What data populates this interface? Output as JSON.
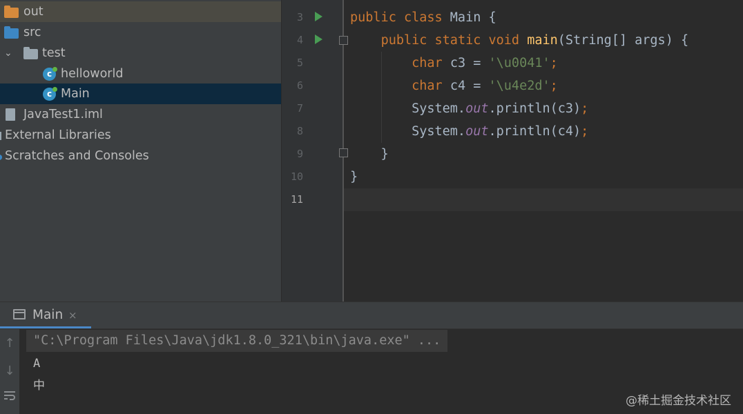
{
  "project_tree": {
    "items": [
      {
        "label": "out",
        "icon": "folder-icon",
        "icon_color": "#d68a3c"
      },
      {
        "label": "src",
        "icon": "folder-icon",
        "icon_color": "#3d87c4"
      },
      {
        "label": "test",
        "icon": "package-folder-icon",
        "icon_color": "#9aa7b0",
        "expanded": true
      },
      {
        "label": "helloworld",
        "icon": "java-class-icon"
      },
      {
        "label": "Main",
        "icon": "java-class-icon",
        "selected": true
      },
      {
        "label": "JavaTest1.iml",
        "icon": "module-file-icon"
      },
      {
        "label": "External Libraries",
        "icon": "libraries-icon"
      },
      {
        "label": "Scratches and Consoles",
        "icon": "scratches-icon"
      }
    ],
    "selected_color": "#0d293e"
  },
  "editor": {
    "line_numbers": [
      "3",
      "4",
      "5",
      "6",
      "7",
      "8",
      "9",
      "10",
      "11"
    ],
    "current_line": "11",
    "lines": [
      {
        "tokens": [
          [
            "kw",
            "public "
          ],
          [
            "kw",
            "class "
          ],
          [
            "plain",
            "Main {"
          ]
        ]
      },
      {
        "tokens": [
          [
            "plain",
            "    "
          ],
          [
            "kw",
            "public "
          ],
          [
            "kw",
            "static "
          ],
          [
            "kw",
            "void "
          ],
          [
            "fn",
            "main"
          ],
          [
            "plain",
            "(String[] args) {"
          ]
        ]
      },
      {
        "tokens": [
          [
            "plain",
            "        "
          ],
          [
            "kw",
            "char "
          ],
          [
            "plain",
            "c3 = "
          ],
          [
            "str",
            "'\\u0041'"
          ],
          [
            "punc",
            ";"
          ]
        ]
      },
      {
        "tokens": [
          [
            "plain",
            "        "
          ],
          [
            "kw",
            "char "
          ],
          [
            "plain",
            "c4 = "
          ],
          [
            "str",
            "'\\u4e2d'"
          ],
          [
            "punc",
            ";"
          ]
        ]
      },
      {
        "tokens": [
          [
            "plain",
            "        System."
          ],
          [
            "fld",
            "out"
          ],
          [
            "plain",
            ".println(c3)"
          ],
          [
            "punc",
            ";"
          ]
        ]
      },
      {
        "tokens": [
          [
            "plain",
            "        System."
          ],
          [
            "fld",
            "out"
          ],
          [
            "plain",
            ".println(c4)"
          ],
          [
            "punc",
            ";"
          ]
        ]
      },
      {
        "tokens": [
          [
            "plain",
            "    }"
          ]
        ]
      },
      {
        "tokens": [
          [
            "plain",
            "}"
          ]
        ]
      },
      {
        "tokens": [
          [
            "plain",
            ""
          ]
        ]
      }
    ],
    "colors": {
      "keyword": "#cc7832",
      "function": "#ffc66d",
      "string": "#6a8759",
      "field": "#9876aa",
      "text": "#a9b7c6",
      "run_gutter": "#499c54"
    }
  },
  "run_panel": {
    "tab_label": "Main",
    "tab_close": "×",
    "toolbar": {
      "up_icon": "↑",
      "down_icon": "↓",
      "wrap_icon": "wrap-icon"
    },
    "command": "\"C:\\Program Files\\Java\\jdk1.8.0_321\\bin\\java.exe\" ...",
    "output": [
      "A",
      "中"
    ]
  },
  "watermark": "@稀土掘金技术社区"
}
